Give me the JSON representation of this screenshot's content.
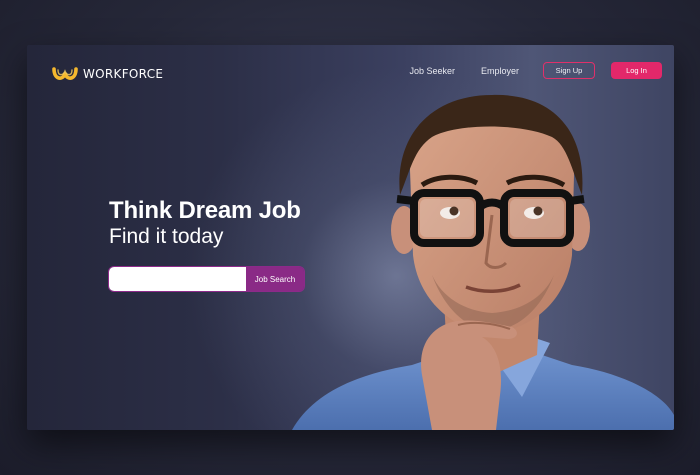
{
  "brand": {
    "name": "WORKFORCE",
    "accent_color": "#f5b82e"
  },
  "nav": {
    "links": [
      "Job Seeker",
      "Employer"
    ],
    "signup_label": "Sign Up",
    "login_label": "Log In",
    "accent_color": "#e3286a"
  },
  "hero": {
    "title": "Think Dream Job",
    "subtitle": "Find it today"
  },
  "search": {
    "placeholder": "",
    "button_label": "Job Search",
    "button_color": "#8a2a86"
  },
  "illustration": {
    "icon": "man-with-glasses-thinking"
  }
}
